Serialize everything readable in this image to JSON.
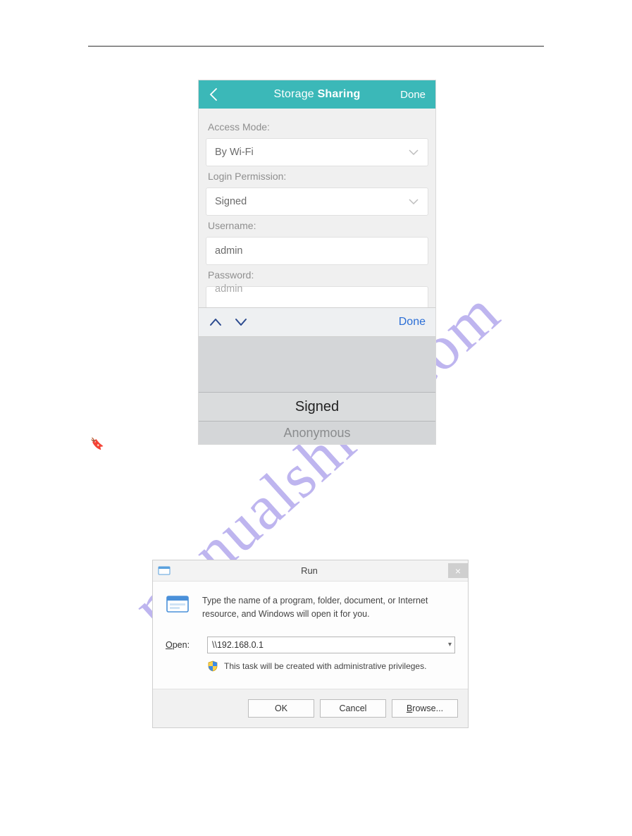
{
  "watermark": "manualshive.com",
  "phone": {
    "header": {
      "title_prefix": "Storage ",
      "title_bold": "Sharing",
      "done": "Done"
    },
    "labels": {
      "access_mode": "Access Mode:",
      "login_permission": "Login Permission:",
      "username": "Username:",
      "password": "Password:"
    },
    "values": {
      "access_mode": "By Wi-Fi",
      "login_permission": "Signed",
      "username": "admin",
      "password": "admin"
    },
    "keyboard": {
      "done": "Done"
    },
    "picker": {
      "selected": "Signed",
      "dimmed": "Anonymous"
    }
  },
  "run": {
    "title": "Run",
    "close": "×",
    "description": "Type the name of a program, folder, document, or Internet resource, and Windows will open it for you.",
    "open_label_prefix": "O",
    "open_label_rest": "pen:",
    "open_value": "\\\\192.168.0.1",
    "admin_notice": "This task will be created with administrative privileges.",
    "buttons": {
      "ok": "OK",
      "cancel": "Cancel",
      "browse_prefix": "B",
      "browse_rest": "rowse..."
    }
  }
}
